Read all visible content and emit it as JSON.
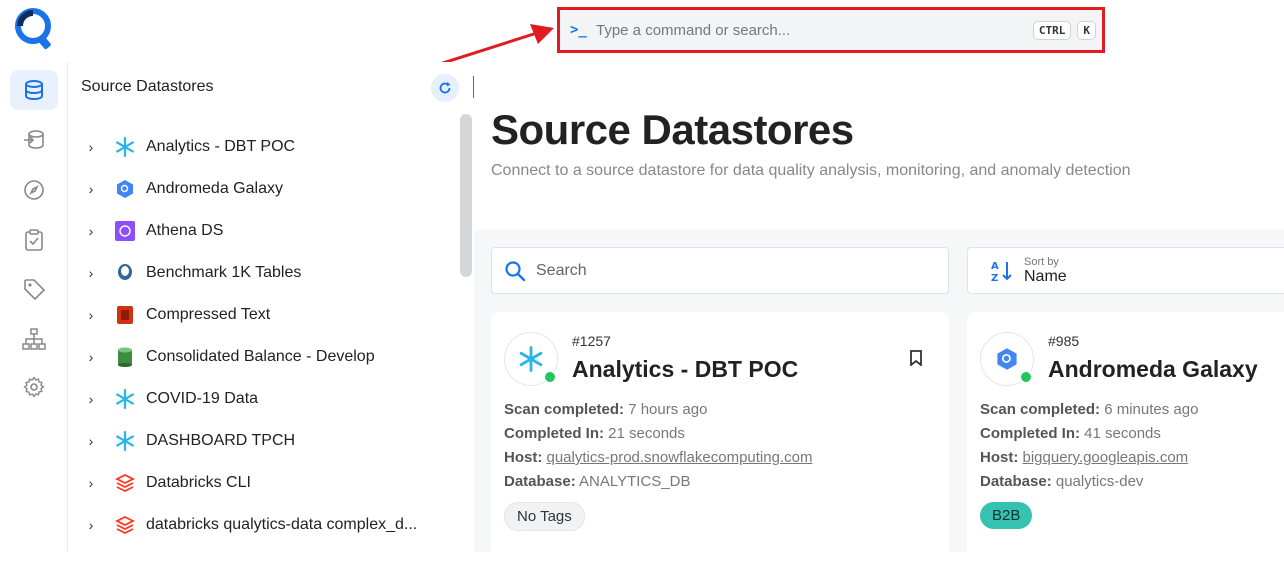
{
  "command_bar": {
    "placeholder": "Type a command or search...",
    "prompt_symbol": ">_",
    "shortcut_keys": [
      "CTRL",
      "K"
    ]
  },
  "rail": {
    "items": [
      "database-icon",
      "datastores-icon",
      "compass-icon",
      "checklist-icon",
      "tag-icon",
      "hierarchy-icon",
      "gear-icon"
    ]
  },
  "tree": {
    "title": "Source Datastores",
    "items": [
      {
        "label": "Analytics - DBT POC",
        "icon": "snowflake-icon"
      },
      {
        "label": "Andromeda Galaxy",
        "icon": "bigquery-icon"
      },
      {
        "label": "Athena DS",
        "icon": "athena-icon"
      },
      {
        "label": "Benchmark 1K Tables",
        "icon": "postgres-icon"
      },
      {
        "label": "Compressed Text",
        "icon": "s3-icon"
      },
      {
        "label": "Consolidated Balance - Develop",
        "icon": "db-cylinder-icon"
      },
      {
        "label": "COVID-19 Data",
        "icon": "snowflake-icon"
      },
      {
        "label": "DASHBOARD TPCH",
        "icon": "snowflake-icon"
      },
      {
        "label": "Databricks CLI",
        "icon": "databricks-icon"
      },
      {
        "label": "databricks qualytics-data complex_d...",
        "icon": "databricks-icon"
      }
    ]
  },
  "main": {
    "title": "Source Datastores",
    "subtitle": "Connect to a source datastore for data quality analysis, monitoring, and anomaly detection",
    "search_placeholder": "Search",
    "sort": {
      "caption": "Sort by",
      "value": "Name"
    }
  },
  "cards": [
    {
      "id": "#1257",
      "name": "Analytics - DBT POC",
      "icon": "snowflake-icon",
      "scan_label": "Scan completed:",
      "scan_value": "7 hours ago",
      "completed_label": "Completed In:",
      "completed_value": "21 seconds",
      "host_label": "Host:",
      "host_value": "qualytics-prod.snowflakecomputing.com",
      "db_label": "Database:",
      "db_value": "ANALYTICS_DB",
      "tag": "No Tags"
    },
    {
      "id": "#985",
      "name": "Andromeda Galaxy",
      "icon": "bigquery-icon",
      "scan_label": "Scan completed:",
      "scan_value": "6 minutes ago",
      "completed_label": "Completed In:",
      "completed_value": "41 seconds",
      "host_label": "Host:",
      "host_value": "bigquery.googleapis.com",
      "db_label": "Database:",
      "db_value": "qualytics-dev",
      "tag": "B2B"
    }
  ],
  "colors": {
    "accent": "#1a73e8",
    "highlight_border": "#e01b22",
    "status_online": "#22c55e",
    "tag_b2b": "#35c2b0"
  }
}
